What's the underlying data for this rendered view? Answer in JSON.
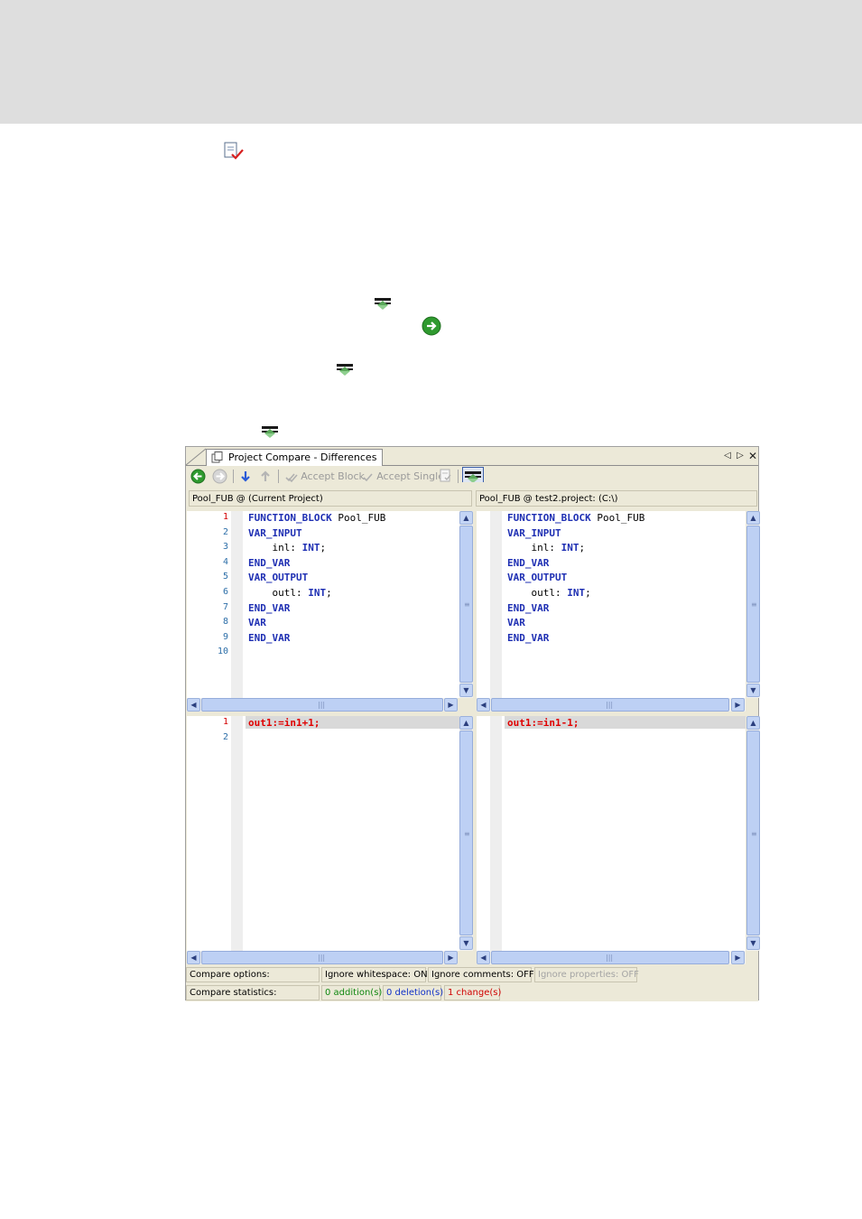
{
  "window": {
    "tab_title": "Project Compare - Differences"
  },
  "toolbar": {
    "accept_block_label": "Accept Block",
    "accept_single_label": "Accept Single"
  },
  "left": {
    "path": "Pool_FUB @ (Current Project)",
    "top_lines": [
      {
        "n": "1",
        "code": "FUNCTION_BLOCK Pool_FUB"
      },
      {
        "n": "2",
        "code": "VAR_INPUT"
      },
      {
        "n": "3",
        "code": "    inl: INT;"
      },
      {
        "n": "4",
        "code": "END_VAR"
      },
      {
        "n": "5",
        "code": "VAR_OUTPUT"
      },
      {
        "n": "6",
        "code": "    outl: INT;"
      },
      {
        "n": "7",
        "code": "END_VAR"
      },
      {
        "n": "8",
        "code": "VAR"
      },
      {
        "n": "9",
        "code": "END_VAR"
      },
      {
        "n": "10",
        "code": ""
      }
    ],
    "bottom_lines": [
      {
        "n": "1",
        "code": "out1:=in1+1;"
      },
      {
        "n": "2",
        "code": ""
      }
    ]
  },
  "right": {
    "path": "Pool_FUB @ test2.project: (C:\\)",
    "top_lines": [
      {
        "code": "FUNCTION_BLOCK Pool_FUB"
      },
      {
        "code": "VAR_INPUT"
      },
      {
        "code": "    inl: INT;"
      },
      {
        "code": "END_VAR"
      },
      {
        "code": "VAR_OUTPUT"
      },
      {
        "code": "    outl: INT;"
      },
      {
        "code": "END_VAR"
      },
      {
        "code": "VAR"
      },
      {
        "code": "END_VAR"
      }
    ],
    "bottom_lines": [
      {
        "code": "out1:=in1-1;"
      }
    ]
  },
  "status": {
    "options_label": "Compare options:",
    "ignore_whitespace": "Ignore whitespace: ON",
    "ignore_comments": "Ignore comments: OFF",
    "ignore_properties": "Ignore properties: OFF",
    "statistics_label": "Compare statistics:",
    "additions": "0 addition(s)",
    "deletions": "0 deletion(s)",
    "changes": "1 change(s)"
  },
  "colors": {
    "keyword": "#1e2fb3",
    "diff_text": "#e00000",
    "line_number": "#2c6ea8"
  }
}
